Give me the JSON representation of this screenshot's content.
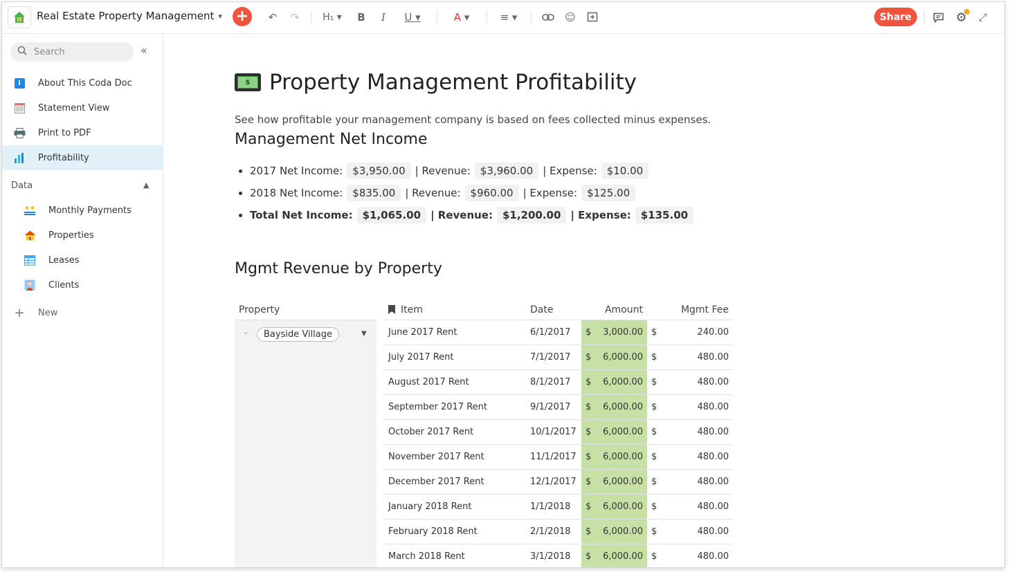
{
  "topbar": {
    "doc_title": "Real Estate Property Management",
    "share_label": "Share"
  },
  "sidebar": {
    "search_placeholder": "Search",
    "pages": [
      {
        "label": "About This Coda Doc",
        "icon": "info-icon"
      },
      {
        "label": "Statement View",
        "icon": "statement-icon"
      },
      {
        "label": "Print to PDF",
        "icon": "printer-icon"
      },
      {
        "label": "Profitability",
        "icon": "bar-chart-icon",
        "active": true
      }
    ],
    "section_label": "Data",
    "data_pages": [
      {
        "label": "Monthly Payments",
        "icon": "people-exchange-icon"
      },
      {
        "label": "Properties",
        "icon": "house-icon"
      },
      {
        "label": "Leases",
        "icon": "table-icon"
      },
      {
        "label": "Clients",
        "icon": "person-icon"
      }
    ],
    "new_label": "New"
  },
  "page": {
    "title": "Property Management Profitability",
    "description": "See how profitable your management company is based on fees collected minus expenses.",
    "section1": "Management Net Income",
    "income": [
      {
        "label": "2017 Net Income:",
        "net": "$3,950.00",
        "rev_label": "| Revenue:",
        "rev": "$3,960.00",
        "exp_label": "| Expense:",
        "exp": "$10.00"
      },
      {
        "label": "2018 Net Income:",
        "net": "$835.00",
        "rev_label": "| Revenue:",
        "rev": "$960.00",
        "exp_label": "| Expense:",
        "exp": "$125.00"
      },
      {
        "label": "Total Net Income:",
        "net": "$1,065.00",
        "rev_label": "| Revenue:",
        "rev": "$1,200.00",
        "exp_label": "| Expense:",
        "exp": "$135.00"
      }
    ],
    "section2": "Mgmt Revenue by Property"
  },
  "table": {
    "headers": {
      "property": "Property",
      "item": "Item",
      "date": "Date",
      "amount": "Amount",
      "fee": "Mgmt Fee"
    },
    "property_value": "Bayside Village",
    "currency": "$",
    "amount_color": "#c6e0a6",
    "rows": [
      {
        "item": "June 2017 Rent",
        "date": "6/1/2017",
        "amount": "3,000.00",
        "fee": "240.00"
      },
      {
        "item": "July 2017 Rent",
        "date": "7/1/2017",
        "amount": "6,000.00",
        "fee": "480.00"
      },
      {
        "item": "August 2017 Rent",
        "date": "8/1/2017",
        "amount": "6,000.00",
        "fee": "480.00"
      },
      {
        "item": "September 2017 Rent",
        "date": "9/1/2017",
        "amount": "6,000.00",
        "fee": "480.00"
      },
      {
        "item": "October 2017 Rent",
        "date": "10/1/2017",
        "amount": "6,000.00",
        "fee": "480.00"
      },
      {
        "item": "November 2017 Rent",
        "date": "11/1/2017",
        "amount": "6,000.00",
        "fee": "480.00"
      },
      {
        "item": "December 2017 Rent",
        "date": "12/1/2017",
        "amount": "6,000.00",
        "fee": "480.00"
      },
      {
        "item": "January 2018 Rent",
        "date": "1/1/2018",
        "amount": "6,000.00",
        "fee": "480.00"
      },
      {
        "item": "February 2018 Rent",
        "date": "2/1/2018",
        "amount": "6,000.00",
        "fee": "480.00"
      },
      {
        "item": "March 2018 Rent",
        "date": "3/1/2018",
        "amount": "6,000.00",
        "fee": "480.00"
      }
    ]
  },
  "colors": {
    "accent": "#f0533e",
    "active_nav": "#e2f0f7"
  }
}
